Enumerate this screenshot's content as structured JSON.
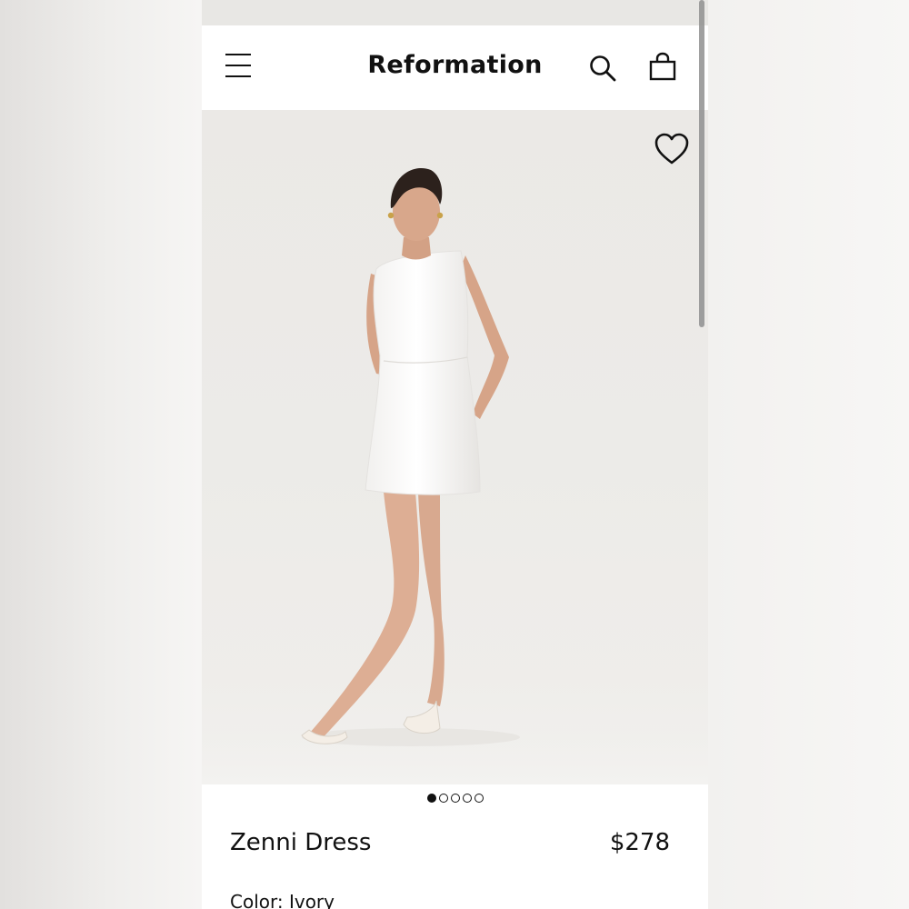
{
  "header": {
    "brand": "Reformation",
    "menu_icon": "hamburger-menu-icon",
    "search_icon": "search-icon",
    "bag_icon": "shopping-bag-icon"
  },
  "gallery": {
    "favorite_icon": "heart-outline-icon",
    "image_count": 5,
    "active_index": 0
  },
  "product": {
    "name": "Zenni Dress",
    "price": "$278",
    "color_line": "Color: Ivory"
  },
  "colors": {
    "text": "#111111",
    "background": "#ffffff",
    "photo_backdrop": "#ecebe8"
  }
}
